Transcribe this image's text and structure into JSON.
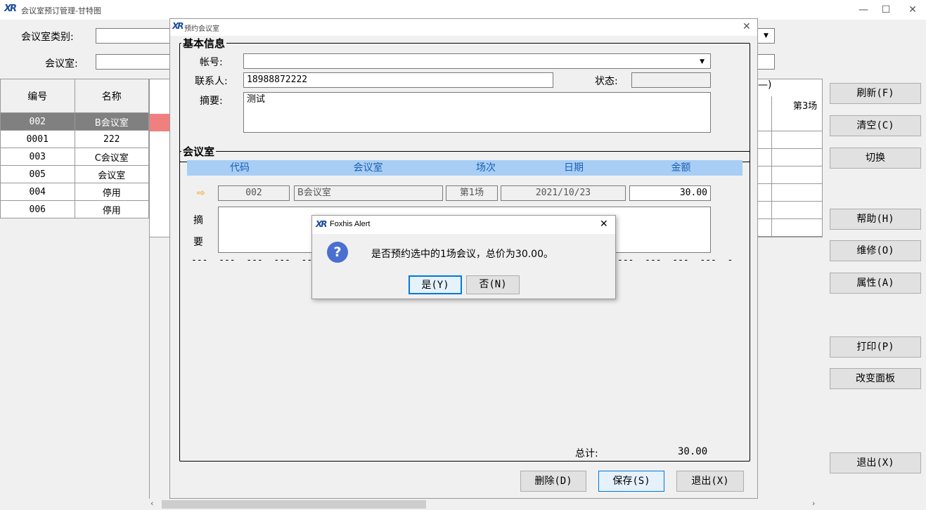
{
  "main_window": {
    "title": "会议室预订管理-甘特图",
    "filter": {
      "room_type_label": "会议室类别:",
      "room_label": "会议室:"
    },
    "table": {
      "col_id": "编号",
      "col_name": "名称",
      "rows": [
        {
          "id": "002",
          "name": "B会议室"
        },
        {
          "id": "0001",
          "name": "222"
        },
        {
          "id": "003",
          "name": "C会议室"
        },
        {
          "id": "005",
          "name": "会议室"
        },
        {
          "id": "004",
          "name": "停用"
        },
        {
          "id": "006",
          "name": "停用"
        }
      ]
    },
    "gantt": {
      "date_header_fragment": "—)",
      "slot_label": "第3场"
    },
    "buttons": {
      "refresh": "刷新(F)",
      "clear": "清空(C)",
      "switch": "切换",
      "help": "帮助(H)",
      "repair": "维修(O)",
      "property": "属性(A)",
      "print": "打印(P)",
      "change_panel": "改变面板",
      "exit": "退出(X)"
    }
  },
  "booking_dialog": {
    "title": "预约会议室",
    "basic_info": {
      "legend": "基本信息",
      "account_label": "帐号:",
      "account_value": "",
      "contact_label": "联系人:",
      "contact_value": "18988872222",
      "status_label": "状态:",
      "status_value": "",
      "summary_label": "摘要:",
      "summary_value": "测试"
    },
    "rooms": {
      "legend": "会议室",
      "headers": {
        "code": "代码",
        "room": "会议室",
        "slot": "场次",
        "date": "日期",
        "amount": "金额"
      },
      "row": {
        "code": "002",
        "room": "B会议室",
        "slot": "第1场",
        "date": "2021/10/23",
        "amount": "30.00"
      },
      "remark_label_1": "摘",
      "remark_label_2": "要",
      "dash_line": "---  ---  ---  ---  ---",
      "dash_line_right": "---  ---  ---  ---  -",
      "total_label": "总计:",
      "total_value": "30.00"
    },
    "buttons": {
      "delete": "删除(D)",
      "save": "保存(S)",
      "exit": "退出(X)"
    }
  },
  "alert": {
    "title": "Foxhis Alert",
    "message": "是否预约选中的1场会议，总价为30.00。",
    "yes": "是(Y)",
    "no": "否(N)"
  },
  "colors": {
    "selected_row": "#808080",
    "header_blue": "#a8cef5",
    "booked_cell": "#f08080",
    "accent": "#0078d7"
  }
}
